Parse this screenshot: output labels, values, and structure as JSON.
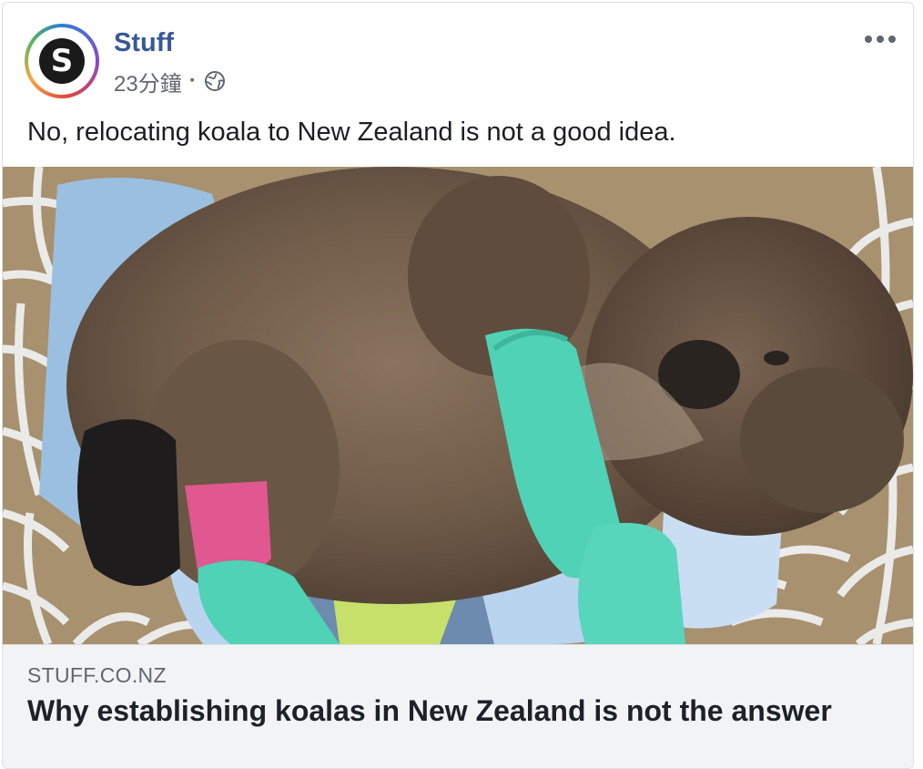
{
  "post": {
    "page_name": "Stuff",
    "avatar_letter": "S",
    "timestamp": "23分鐘",
    "separator": "·",
    "privacy_icon": "globe-icon",
    "more_icon": "more-options-icon",
    "text": "No, relocating koala to New Zealand is not a good idea."
  },
  "image": {
    "description_icon": "koala-photo"
  },
  "link_preview": {
    "domain": "STUFF.CO.NZ",
    "title": "Why establishing koalas in New Zealand is not the answer"
  },
  "colors": {
    "page_name": "#385898",
    "meta_text": "#616770",
    "body_text": "#1c1e21",
    "preview_bg": "#f2f3f5"
  }
}
